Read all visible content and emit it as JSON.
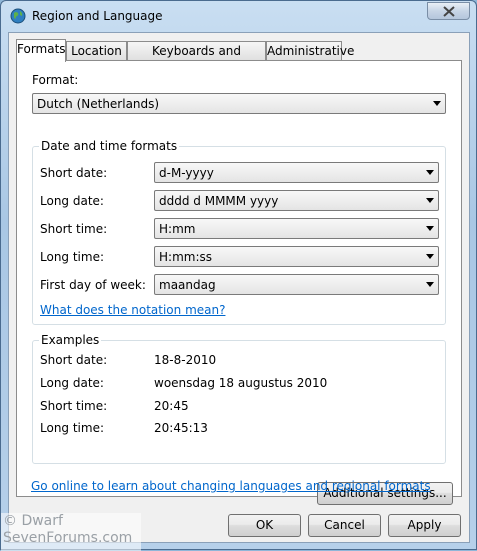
{
  "window": {
    "title": "Region and Language"
  },
  "tabs": [
    {
      "label": "Formats",
      "active": true
    },
    {
      "label": "Location",
      "active": false
    },
    {
      "label": "Keyboards and Languages",
      "active": false
    },
    {
      "label": "Administrative",
      "active": false
    }
  ],
  "format": {
    "label": "Format:",
    "value": "Dutch (Netherlands)"
  },
  "datetime": {
    "title": "Date and time formats",
    "rows": [
      {
        "label": "Short date:",
        "value": "d-M-yyyy"
      },
      {
        "label": "Long date:",
        "value": "dddd d MMMM yyyy"
      },
      {
        "label": "Short time:",
        "value": "H:mm"
      },
      {
        "label": "Long time:",
        "value": "H:mm:ss"
      },
      {
        "label": "First day of week:",
        "value": "maandag"
      }
    ],
    "notation_link": "What does the notation mean?"
  },
  "examples": {
    "title": "Examples",
    "rows": [
      {
        "label": "Short date:",
        "value": "18-8-2010"
      },
      {
        "label": "Long date:",
        "value": "woensdag 18 augustus 2010"
      },
      {
        "label": "Short time:",
        "value": "20:45"
      },
      {
        "label": "Long time:",
        "value": "20:45:13"
      }
    ]
  },
  "additional_settings": "Additional settings...",
  "online_link": "Go online to learn about changing languages and regional formats",
  "buttons": {
    "ok": "OK",
    "cancel": "Cancel",
    "apply": "Apply"
  },
  "watermark": {
    "line1": "© Dwarf",
    "line2": "SevenForums.com"
  },
  "icons": {
    "app": "globe-icon",
    "close": "close-icon",
    "dropdown": "chevron-down-icon"
  }
}
